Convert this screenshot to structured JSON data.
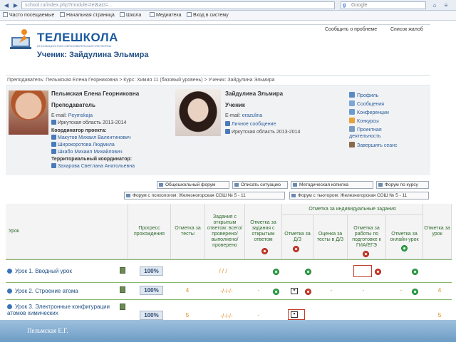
{
  "browser": {
    "url": "school.ru/index.php?module=tel&act=...",
    "search_placeholder": "Google",
    "favorites": [
      "Часто посещаемые",
      "Начальная страница",
      "Школа",
      "Медиатека",
      "Вход в систему"
    ]
  },
  "site": {
    "logo": "ТЕЛЕШКОЛА",
    "logo_sub": "ИННОВАЦИОННАЯ ОБРАЗОВАТЕЛЬНАЯ ПЛАТФОРМА",
    "top_links": [
      "Сообщить о проблеме",
      "Список жалоб"
    ],
    "page_title": "Ученик: Зайдулина Эльмира"
  },
  "breadcrumb": "Преподаватель: Пельмская Елена Георниковна > Курс: Химия 11 (базовый уровень) > Ученик: Зайдулина Эльмира",
  "teacher": {
    "name": "Пельмская Елена Георниковна",
    "role": "Преподаватель",
    "email_label": "E-mail:",
    "email": "Peymskaja",
    "region": "Иркутская область 2013-2014",
    "coord_label": "Координатор проекта:",
    "coordinators": [
      "Макутов Михаил Валентинович",
      "Широкоротова Людмила",
      "Шкабо Михаил Михайлович"
    ],
    "terr_label": "Территориальный координатор:",
    "terr_coord": "Захарова Светлана Анатольевна"
  },
  "student": {
    "name": "Зайдулина Эльмира",
    "role": "Ученик",
    "email_label": "E-mail:",
    "email": "erazulina",
    "message": "Личное сообщение",
    "region": "Иркутская область 2013-2014"
  },
  "side_menu": [
    "Профиль",
    "Сообщения",
    "Конференции",
    "Конкурсы",
    "Проектная деятельность",
    "Завершить сеанс"
  ],
  "actions_row1": [
    "Общешкольный форум",
    "Описать ситуацию",
    "Методическая копилка",
    "Форум по курсу"
  ],
  "actions_row2": [
    "Форум с психологом: Железногорская СОШ № 5 - 11",
    "Форум с тьютором: Железногорская СОШ № 5 - 11"
  ],
  "table": {
    "headers": {
      "lesson": "Урок",
      "progress": "Прогресс прохождения",
      "test_mark": "Отметка за тесты",
      "open_tasks": "Задания с открытым ответом: всего/ проверено/ выполнено/ проверено",
      "task_mark": "Отметка за задания с открытым ответом",
      "group": "Отметка за индивидуальные задания",
      "dz": "Отметка за Д/З",
      "test_dz": "Оценка за тесты в Д/З",
      "exam": "Отметка за работы по подготовке к ГИА/ЕГЭ",
      "online": "Отметка за онлайн-урок",
      "lesson_mark": "Отметка за урок"
    },
    "rows": [
      {
        "title": "Урок 1. Вводный урок",
        "progress": "100%",
        "test": "",
        "open": "/ / /",
        "task": "",
        "dz": "",
        "test_dz": "",
        "exam": "",
        "online": "",
        "mark": ""
      },
      {
        "title": "Урок 2. Строение атома",
        "progress": "100%",
        "test": "4",
        "open": "-/-/-/-",
        "task": "-",
        "dz": "",
        "test_dz": "-",
        "exam": "-",
        "online": "-",
        "mark": "4"
      },
      {
        "title": "Урок 3. Электронные конфигурации атомов химических",
        "progress": "100%",
        "test": "5",
        "open": "-/-/-/-",
        "task": "-",
        "dz": "",
        "test_dz": "-",
        "exam": "-",
        "online": "-",
        "mark": "5"
      }
    ]
  },
  "footer": "Пельмская Е.Г."
}
